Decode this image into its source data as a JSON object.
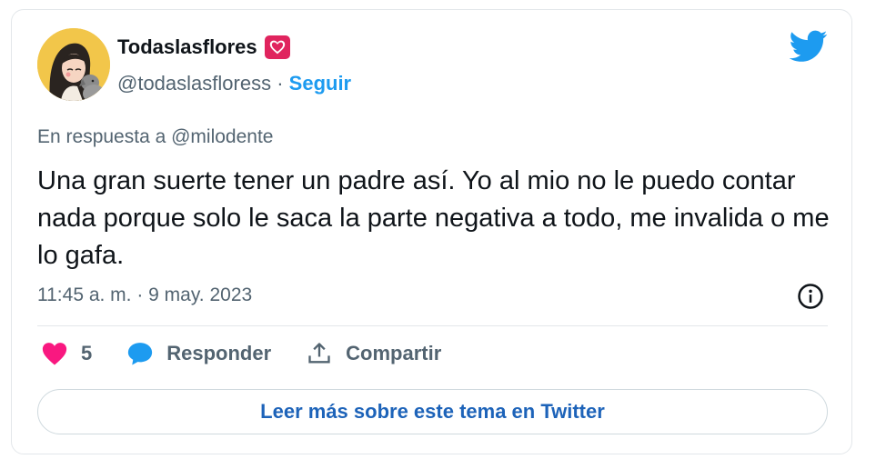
{
  "author": {
    "display_name": "Todaslasflores",
    "handle": "@todaslasfloress",
    "separator": "·",
    "follow_label": "Seguir",
    "avatar": "illustrated-woman-with-dog-avatar",
    "badge": "heart-emoji-icon"
  },
  "tweet": {
    "reply_prefix": "En respuesta a",
    "reply_to": "@milodente",
    "text": "Una gran suerte tener un padre así. Yo al mio no le puedo contar nada porque solo le saca la parte negativa a todo, me invalida o me lo gafa.",
    "timestamp": "11:45 a. m. · 9 may. 2023"
  },
  "actions": {
    "like_count": "5",
    "reply_label": "Responder",
    "share_label": "Compartir"
  },
  "footer": {
    "read_more_label": "Leer más sobre este tema en Twitter"
  },
  "colors": {
    "twitter_blue": "#1d9bf0",
    "like_pink": "#f91880",
    "text_primary": "#0f1419",
    "text_secondary": "#536471",
    "link_dark_blue": "#1d63b9"
  },
  "icons": [
    "twitter-bird-icon",
    "info-icon",
    "heart-icon",
    "reply-bubble-icon",
    "share-icon"
  ]
}
